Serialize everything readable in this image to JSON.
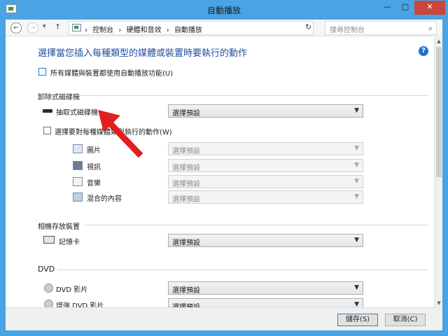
{
  "window": {
    "title": "自動播放",
    "min": "—",
    "max": "□",
    "close": "✕"
  },
  "nav": {
    "back": "←",
    "forward": "→",
    "dropdown": "▾",
    "up": "↑",
    "crumbs": [
      "控制台",
      "硬體和音效",
      "自動播放"
    ],
    "crumb_sep": "›",
    "refresh": "↻",
    "search_placeholder": "搜尋控制台",
    "search_icon": "⌕"
  },
  "page": {
    "title": "選擇當您插入每種類型的媒體或裝置時要執行的動作",
    "help": "?",
    "use_autoplay_label": "所有媒體與裝置都使用自動播放功能(U)"
  },
  "removable": {
    "section": "卸除式磁碟機",
    "drive_label": "抽取式磁碟機",
    "drive_value": "選擇預設",
    "per_type_label": "選擇要對每種媒體類型執行的動作(W)",
    "items": [
      {
        "icon": "picture-icon",
        "label": "圖片",
        "value": "選擇預設"
      },
      {
        "icon": "video-icon",
        "label": "視訊",
        "value": "選擇預設"
      },
      {
        "icon": "music-icon",
        "label": "音樂",
        "value": "選擇預設"
      },
      {
        "icon": "mixed-content-icon",
        "label": "混合的內容",
        "value": "選擇預設"
      }
    ]
  },
  "camera": {
    "section": "相機存放裝置",
    "card_label": "記憶卡",
    "card_value": "選擇預設"
  },
  "dvd": {
    "section": "DVD",
    "items": [
      {
        "icon": "dvd-icon",
        "label": "DVD 影片",
        "value": "選擇預設"
      },
      {
        "icon": "dvd-icon",
        "label": "增強 DVD 影片",
        "value": "選擇預設"
      }
    ]
  },
  "footer": {
    "save": "儲存(S)",
    "cancel": "取消(C)"
  },
  "colors": {
    "accent": "#4aa3e2",
    "title_text": "#1e4f9c",
    "close": "#c9463a",
    "arrow": "#e0201c"
  }
}
